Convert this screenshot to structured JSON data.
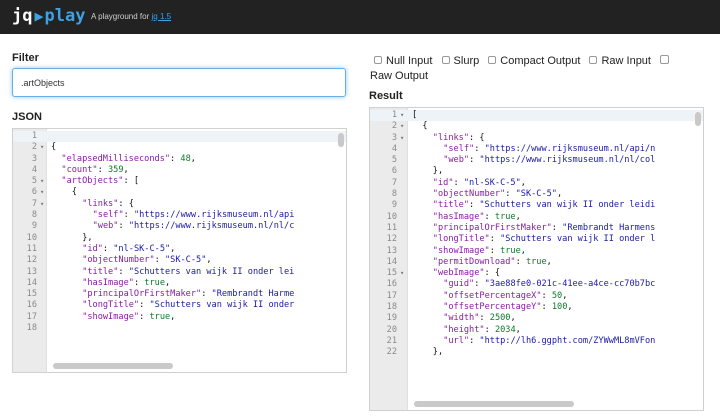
{
  "header": {
    "logo_jq": "jq",
    "logo_play": "play",
    "tagline": "A playground for",
    "tagline_link": "jq 1.5"
  },
  "filter": {
    "label": "Filter",
    "value": ".artObjects"
  },
  "options": {
    "null_input": "Null Input",
    "slurp": "Slurp",
    "compact_output": "Compact Output",
    "raw_input": "Raw Input",
    "raw_output": "Raw Output"
  },
  "json_panel": {
    "label": "JSON",
    "lines": [
      {
        "n": "1",
        "fold": false,
        "active": true,
        "indent": 0,
        "parts": []
      },
      {
        "n": "2",
        "fold": true,
        "indent": 0,
        "parts": [
          [
            "p",
            "{"
          ]
        ]
      },
      {
        "n": "3",
        "fold": false,
        "indent": 2,
        "parts": [
          [
            "k",
            "\"elapsedMilliseconds\""
          ],
          [
            "p",
            ": "
          ],
          [
            "n",
            "48"
          ],
          [
            "p",
            ","
          ]
        ]
      },
      {
        "n": "4",
        "fold": false,
        "indent": 2,
        "parts": [
          [
            "k",
            "\"count\""
          ],
          [
            "p",
            ": "
          ],
          [
            "n",
            "359"
          ],
          [
            "p",
            ","
          ]
        ]
      },
      {
        "n": "5",
        "fold": true,
        "indent": 2,
        "parts": [
          [
            "k",
            "\"artObjects\""
          ],
          [
            "p",
            ": ["
          ]
        ]
      },
      {
        "n": "6",
        "fold": true,
        "indent": 4,
        "parts": [
          [
            "p",
            "{"
          ]
        ]
      },
      {
        "n": "7",
        "fold": true,
        "indent": 6,
        "parts": [
          [
            "k",
            "\"links\""
          ],
          [
            "p",
            ": {"
          ]
        ]
      },
      {
        "n": "8",
        "fold": false,
        "indent": 8,
        "parts": [
          [
            "k",
            "\"self\""
          ],
          [
            "p",
            ": "
          ],
          [
            "s",
            "\"https://www.rijksmuseum.nl/api"
          ]
        ]
      },
      {
        "n": "9",
        "fold": false,
        "indent": 8,
        "parts": [
          [
            "k",
            "\"web\""
          ],
          [
            "p",
            ": "
          ],
          [
            "s",
            "\"https://www.rijksmuseum.nl/nl/c"
          ]
        ]
      },
      {
        "n": "10",
        "fold": false,
        "indent": 6,
        "parts": [
          [
            "p",
            "},"
          ]
        ]
      },
      {
        "n": "11",
        "fold": false,
        "indent": 6,
        "parts": [
          [
            "k",
            "\"id\""
          ],
          [
            "p",
            ": "
          ],
          [
            "s",
            "\"nl-SK-C-5\""
          ],
          [
            "p",
            ","
          ]
        ]
      },
      {
        "n": "12",
        "fold": false,
        "indent": 6,
        "parts": [
          [
            "k",
            "\"objectNumber\""
          ],
          [
            "p",
            ": "
          ],
          [
            "s",
            "\"SK-C-5\""
          ],
          [
            "p",
            ","
          ]
        ]
      },
      {
        "n": "13",
        "fold": false,
        "indent": 6,
        "parts": [
          [
            "k",
            "\"title\""
          ],
          [
            "p",
            ": "
          ],
          [
            "s",
            "\"Schutters van wijk II onder lei"
          ]
        ]
      },
      {
        "n": "14",
        "fold": false,
        "indent": 6,
        "parts": [
          [
            "k",
            "\"hasImage\""
          ],
          [
            "p",
            ": "
          ],
          [
            "n",
            "true"
          ],
          [
            "p",
            ","
          ]
        ]
      },
      {
        "n": "15",
        "fold": false,
        "indent": 6,
        "parts": [
          [
            "k",
            "\"principalOrFirstMaker\""
          ],
          [
            "p",
            ": "
          ],
          [
            "s",
            "\"Rembrandt Harme"
          ]
        ]
      },
      {
        "n": "16",
        "fold": false,
        "indent": 6,
        "parts": [
          [
            "k",
            "\"longTitle\""
          ],
          [
            "p",
            ": "
          ],
          [
            "s",
            "\"Schutters van wijk II onder"
          ]
        ]
      },
      {
        "n": "17",
        "fold": false,
        "indent": 6,
        "parts": [
          [
            "k",
            "\"showImage\""
          ],
          [
            "p",
            ": "
          ],
          [
            "n",
            "true"
          ],
          [
            "p",
            ","
          ]
        ]
      },
      {
        "n": "18",
        "fold": false,
        "indent": 6,
        "parts": []
      }
    ]
  },
  "result_panel": {
    "label": "Result",
    "lines": [
      {
        "n": "1",
        "fold": true,
        "active": true,
        "indent": 0,
        "parts": [
          [
            "p",
            "["
          ]
        ]
      },
      {
        "n": "2",
        "fold": true,
        "indent": 2,
        "parts": [
          [
            "p",
            "{"
          ]
        ]
      },
      {
        "n": "3",
        "fold": true,
        "indent": 4,
        "parts": [
          [
            "k",
            "\"links\""
          ],
          [
            "p",
            ": {"
          ]
        ]
      },
      {
        "n": "4",
        "fold": false,
        "indent": 6,
        "parts": [
          [
            "k",
            "\"self\""
          ],
          [
            "p",
            ": "
          ],
          [
            "s",
            "\"https://www.rijksmuseum.nl/api/n"
          ]
        ]
      },
      {
        "n": "5",
        "fold": false,
        "indent": 6,
        "parts": [
          [
            "k",
            "\"web\""
          ],
          [
            "p",
            ": "
          ],
          [
            "s",
            "\"https://www.rijksmuseum.nl/nl/col"
          ]
        ]
      },
      {
        "n": "6",
        "fold": false,
        "indent": 4,
        "parts": [
          [
            "p",
            "},"
          ]
        ]
      },
      {
        "n": "7",
        "fold": false,
        "indent": 4,
        "parts": [
          [
            "k",
            "\"id\""
          ],
          [
            "p",
            ": "
          ],
          [
            "s",
            "\"nl-SK-C-5\""
          ],
          [
            "p",
            ","
          ]
        ]
      },
      {
        "n": "8",
        "fold": false,
        "indent": 4,
        "parts": [
          [
            "k",
            "\"objectNumber\""
          ],
          [
            "p",
            ": "
          ],
          [
            "s",
            "\"SK-C-5\""
          ],
          [
            "p",
            ","
          ]
        ]
      },
      {
        "n": "9",
        "fold": false,
        "indent": 4,
        "parts": [
          [
            "k",
            "\"title\""
          ],
          [
            "p",
            ": "
          ],
          [
            "s",
            "\"Schutters van wijk II onder leidi"
          ]
        ]
      },
      {
        "n": "10",
        "fold": false,
        "indent": 4,
        "parts": [
          [
            "k",
            "\"hasImage\""
          ],
          [
            "p",
            ": "
          ],
          [
            "n",
            "true"
          ],
          [
            "p",
            ","
          ]
        ]
      },
      {
        "n": "11",
        "fold": false,
        "indent": 4,
        "parts": [
          [
            "k",
            "\"principalOrFirstMaker\""
          ],
          [
            "p",
            ": "
          ],
          [
            "s",
            "\"Rembrandt Harmens"
          ]
        ]
      },
      {
        "n": "12",
        "fold": false,
        "indent": 4,
        "parts": [
          [
            "k",
            "\"longTitle\""
          ],
          [
            "p",
            ": "
          ],
          [
            "s",
            "\"Schutters van wijk II onder l"
          ]
        ]
      },
      {
        "n": "13",
        "fold": false,
        "indent": 4,
        "parts": [
          [
            "k",
            "\"showImage\""
          ],
          [
            "p",
            ": "
          ],
          [
            "n",
            "true"
          ],
          [
            "p",
            ","
          ]
        ]
      },
      {
        "n": "14",
        "fold": false,
        "indent": 4,
        "parts": [
          [
            "k",
            "\"permitDownload\""
          ],
          [
            "p",
            ": "
          ],
          [
            "n",
            "true"
          ],
          [
            "p",
            ","
          ]
        ]
      },
      {
        "n": "15",
        "fold": true,
        "indent": 4,
        "parts": [
          [
            "k",
            "\"webImage\""
          ],
          [
            "p",
            ": {"
          ]
        ]
      },
      {
        "n": "16",
        "fold": false,
        "indent": 6,
        "parts": [
          [
            "k",
            "\"guid\""
          ],
          [
            "p",
            ": "
          ],
          [
            "s",
            "\"3ae88fe0-021c-41ee-a4ce-cc70b7bc"
          ]
        ]
      },
      {
        "n": "17",
        "fold": false,
        "indent": 6,
        "parts": [
          [
            "k",
            "\"offsetPercentageX\""
          ],
          [
            "p",
            ": "
          ],
          [
            "n",
            "50"
          ],
          [
            "p",
            ","
          ]
        ]
      },
      {
        "n": "18",
        "fold": false,
        "indent": 6,
        "parts": [
          [
            "k",
            "\"offsetPercentageY\""
          ],
          [
            "p",
            ": "
          ],
          [
            "n",
            "100"
          ],
          [
            "p",
            ","
          ]
        ]
      },
      {
        "n": "19",
        "fold": false,
        "indent": 6,
        "parts": [
          [
            "k",
            "\"width\""
          ],
          [
            "p",
            ": "
          ],
          [
            "n",
            "2500"
          ],
          [
            "p",
            ","
          ]
        ]
      },
      {
        "n": "20",
        "fold": false,
        "indent": 6,
        "parts": [
          [
            "k",
            "\"height\""
          ],
          [
            "p",
            ": "
          ],
          [
            "n",
            "2034"
          ],
          [
            "p",
            ","
          ]
        ]
      },
      {
        "n": "21",
        "fold": false,
        "indent": 6,
        "parts": [
          [
            "k",
            "\"url\""
          ],
          [
            "p",
            ": "
          ],
          [
            "s",
            "\"http://lh6.ggpht.com/ZYWwML8mVFon"
          ]
        ]
      },
      {
        "n": "22",
        "fold": false,
        "indent": 4,
        "parts": [
          [
            "p",
            "},"
          ]
        ]
      }
    ]
  },
  "colors": {
    "topbar": "#222222",
    "accent": "#3aa3e3",
    "json_key": "#8b1aa8",
    "json_string": "#1a1aa6",
    "json_number": "#0d7a2a"
  }
}
